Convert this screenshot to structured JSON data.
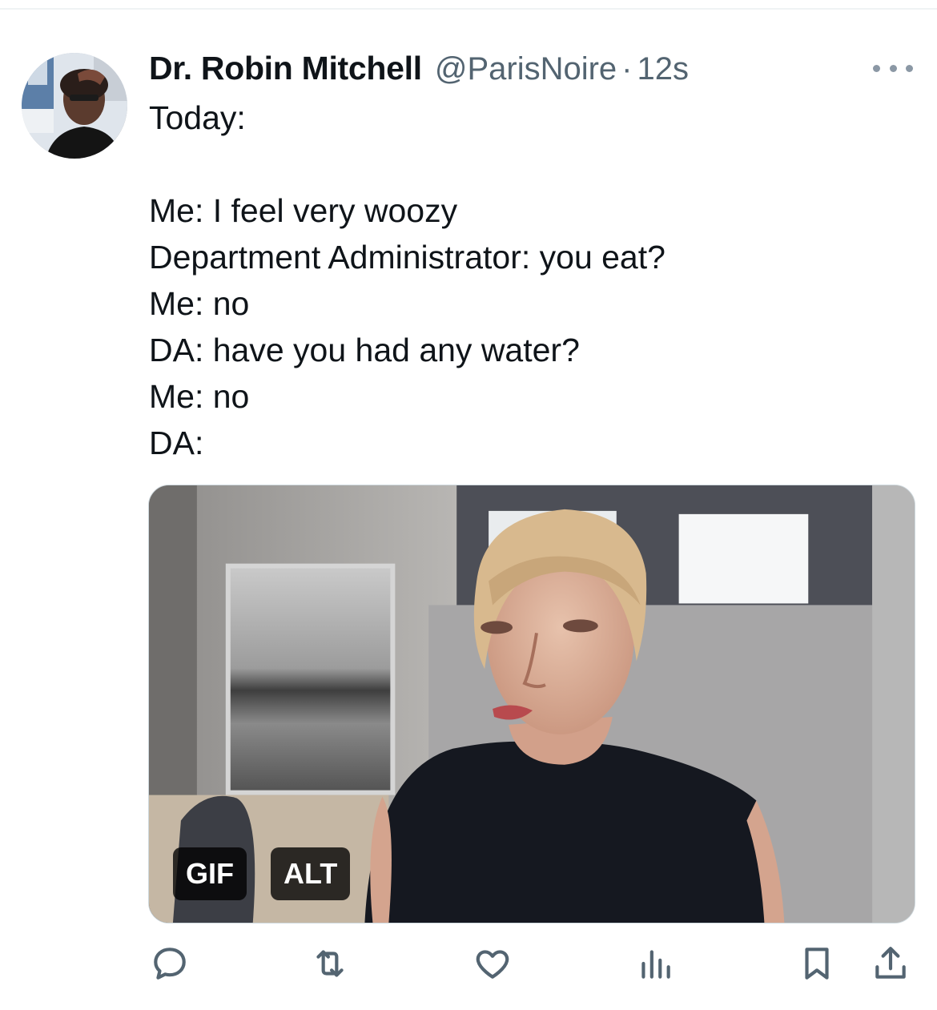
{
  "tweet": {
    "author_name": "Dr. Robin Mitchell",
    "handle": "@ParisNoire",
    "separator": "·",
    "timestamp": "12s",
    "text_lines": [
      "Today:",
      "",
      "Me: I feel very woozy",
      "Department Administrator: you eat?",
      "Me: no",
      "DA: have you had any water?",
      "Me: no",
      "DA:"
    ],
    "media": {
      "type": "gif",
      "gif_badge": "GIF",
      "alt_badge": "ALT"
    }
  },
  "actions": {
    "icons": [
      "reply-icon",
      "retweet-icon",
      "like-icon",
      "views-icon",
      "bookmark-icon",
      "share-icon"
    ]
  },
  "colors": {
    "text_primary": "#0f1419",
    "text_secondary": "#536471",
    "icon_gray": "#536471",
    "divider": "#eff3f4"
  }
}
